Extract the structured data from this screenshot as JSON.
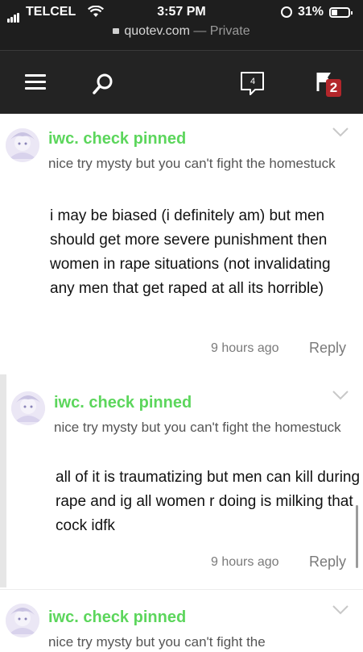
{
  "status_bar": {
    "carrier": "TELCEL",
    "time": "3:57 PM",
    "battery_percent": "31%",
    "url": "quotev.com",
    "url_suffix": "— Private"
  },
  "navbar": {
    "messages_count": "4",
    "notifications_count": "2"
  },
  "comments": [
    {
      "author": "iwc. check pinned",
      "subtitle": "nice try mysty but you can't fight the homestuck",
      "body": "i may be biased (i definitely am) but men should get more severe punishment then women in rape situations (not invalidating any men that get raped at all its horrible)",
      "time": "9 hours ago",
      "reply_label": "Reply"
    },
    {
      "author": "iwc. check pinned",
      "subtitle": "nice try mysty but you can't fight the homestuck",
      "body": "all of it is traumatizing but men can kill during rape and ig all women r doing is milking that cock idfk",
      "time": "9 hours ago",
      "reply_label": "Reply"
    },
    {
      "author": "iwc. check pinned",
      "subtitle": "nice try mysty but you can't fight the"
    }
  ],
  "colors": {
    "author": "#5cd65c",
    "navbar": "#232323",
    "badge": "#b3262b"
  }
}
